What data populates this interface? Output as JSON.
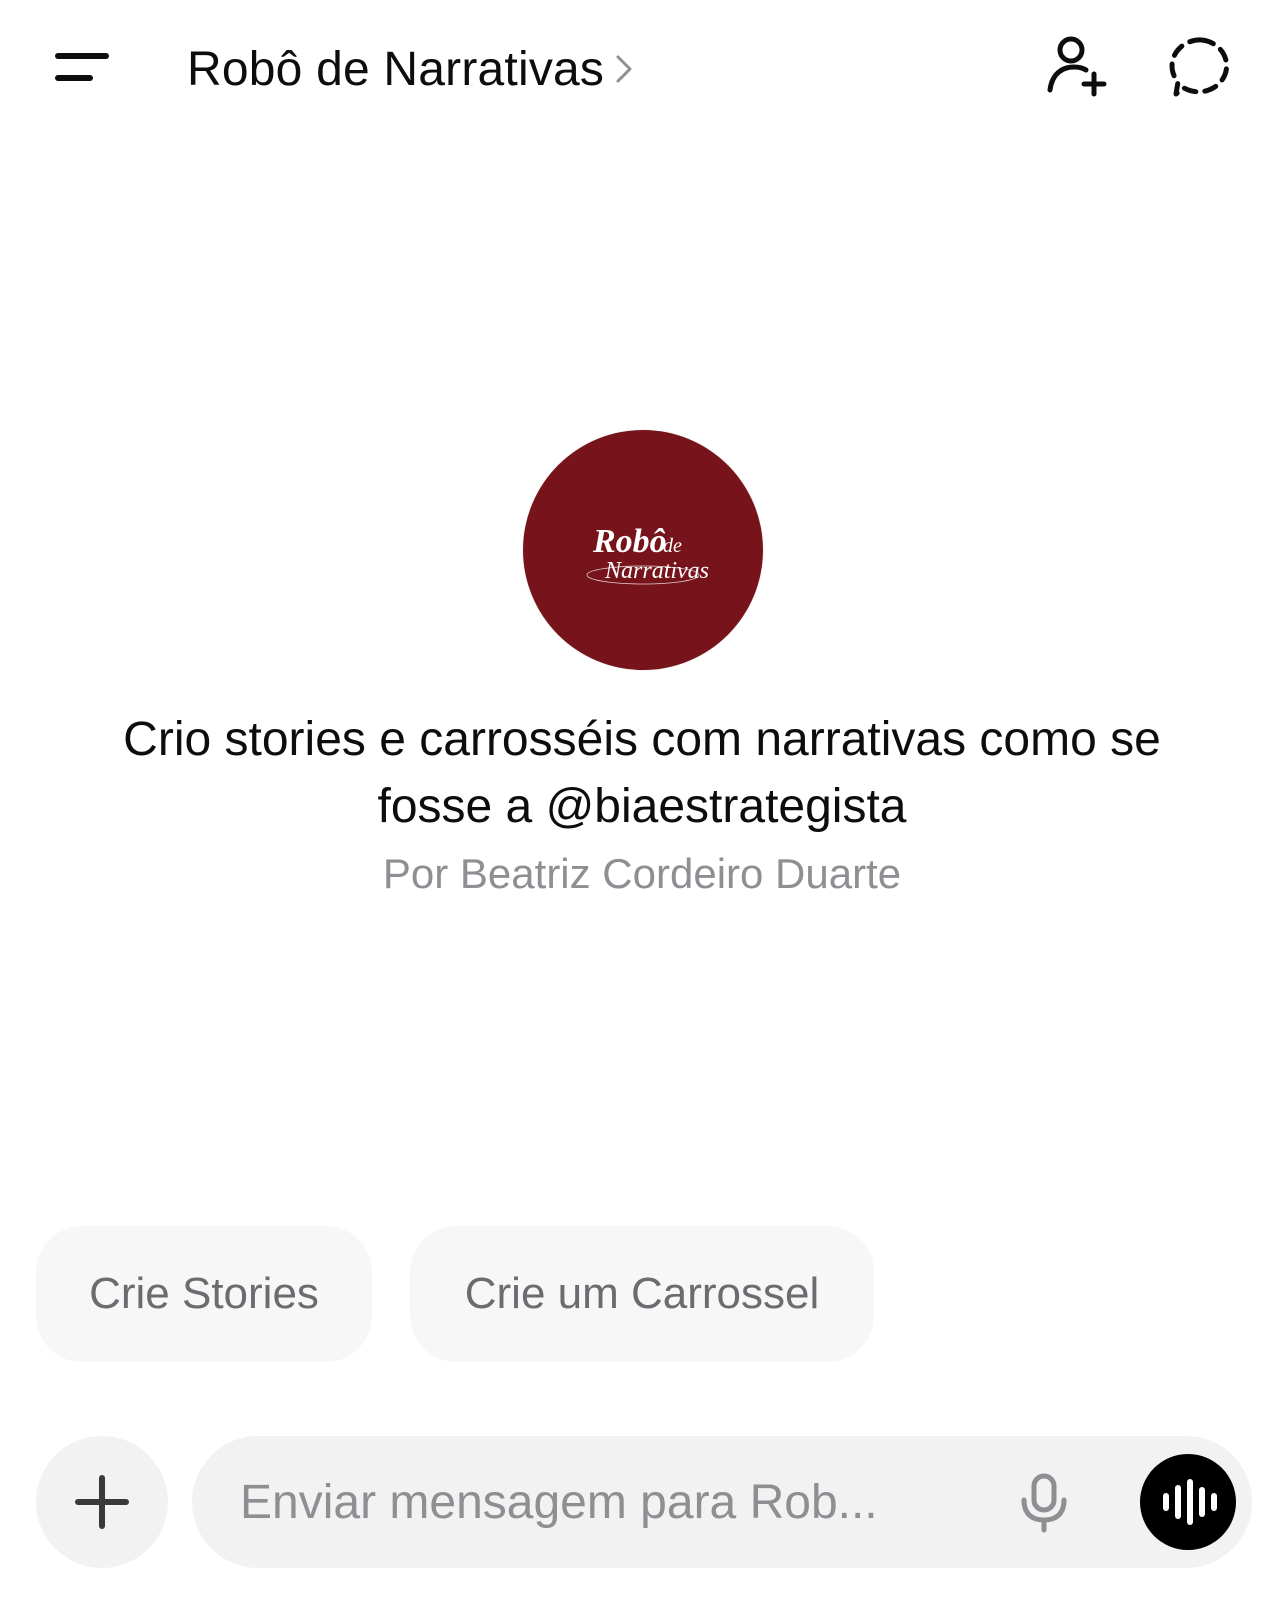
{
  "header": {
    "title": "Robô de Narrativas",
    "menu_icon": "menu-icon",
    "add_user_icon": "add-user-icon",
    "new_chat_icon": "new-chat-icon"
  },
  "gpt": {
    "logo_line1": "Robô",
    "logo_line1_small": "de",
    "logo_line2": "Narrativas",
    "logo_color": "#77141b",
    "description": "Crio stories e carrosséis com narrativas como se fosse a @biaestrategista",
    "author": "Por Beatriz Cordeiro Duarte"
  },
  "suggestions": [
    {
      "label": "Crie Stories"
    },
    {
      "label": "Crie um Carrossel"
    }
  ],
  "composer": {
    "placeholder": "Enviar mensagem para Rob...",
    "value": "",
    "plus_icon": "plus-icon",
    "mic_icon": "microphone-icon",
    "voice_icon": "voice-waveform-icon"
  }
}
